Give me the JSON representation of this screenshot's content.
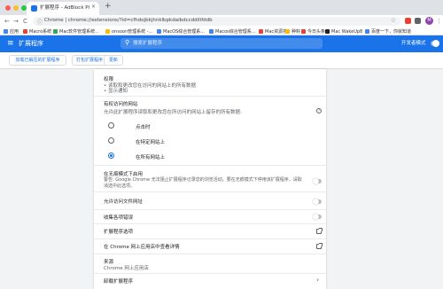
{
  "tab": {
    "title": "扩展程序 - AdBlock Plus - 免…",
    "close": "×",
    "new_tab": "+"
  },
  "toolbar": {
    "back": "←",
    "forward": "→",
    "reload": "C",
    "lock": "ⓘ",
    "url": "Chrome  |  chrome://extensions/?id=cfhdojbkjhnklbpkdaibdccddilifddb",
    "star": "☆",
    "avatar": "M",
    "menu": "⋮"
  },
  "bookmarks": [
    {
      "label": "应用",
      "color": "#4285f4"
    },
    {
      "label": "Macro系统",
      "color": "#e94235"
    },
    {
      "label": "Mac软件管理系统...",
      "color": "#34a853"
    },
    {
      "label": "onsoon管理系统 -...",
      "color": "#fbbc04"
    },
    {
      "label": "MacOS综合管理系...",
      "color": "#4285f4"
    },
    {
      "label": "Macos综合管理系...",
      "color": "#4285f4"
    },
    {
      "label": "Mac资源搜",
      "color": "#e94235"
    },
    {
      "label": "种籽",
      "color": "#fbbc04"
    },
    {
      "label": "今日头条",
      "color": "#e94235"
    },
    {
      "label": "Mac WakeUp8",
      "color": "#202124"
    },
    {
      "label": "百度一下，你就知道",
      "color": "#4285f4"
    }
  ],
  "header": {
    "menu_icon": "≡",
    "title": "扩展程序",
    "search_icon": "⚲",
    "search_placeholder": "搜索扩展程序",
    "dev_mode_label": "开发者模式",
    "dev_mode_on": true,
    "accent": "#1a73e8"
  },
  "actions": {
    "load_unpacked": "加载已解压的扩展程序",
    "pack": "打包扩展程序",
    "update": "更新"
  },
  "details": {
    "permissions_title": "权限",
    "permissions": [
      "读取和更改您在访问的网站上的所有数据",
      "显示通知"
    ],
    "site_access_title": "有权访问的网站",
    "site_access_question": "允许此扩展程序读取和更改您在所访问的网站上留存的所有数据:",
    "help_icon": "?",
    "radio_options": [
      {
        "label": "点击时",
        "selected": false
      },
      {
        "label": "在特定网站上",
        "selected": false
      },
      {
        "label": "在所有网站上",
        "selected": true
      }
    ],
    "incognito_title": "在无痕模式下启用",
    "incognito_warning_1": "警告: Google Chrome 无法阻止扩展程序记录您的浏览活动。要在无痕模式下停用该扩展程序，请取",
    "incognito_warning_2": "消选中此选项。",
    "file_urls_label": "允许访问文件网址",
    "collect_errors_label": "收集各项错误",
    "ext_options_label": "扩展程序选项",
    "webstore_label": "在 Chrome 网上应用店中查看详情",
    "source_title": "来源",
    "source_value": "Chrome 网上应用店",
    "remove_label": "卸载扩展程序",
    "chevron": "›"
  }
}
